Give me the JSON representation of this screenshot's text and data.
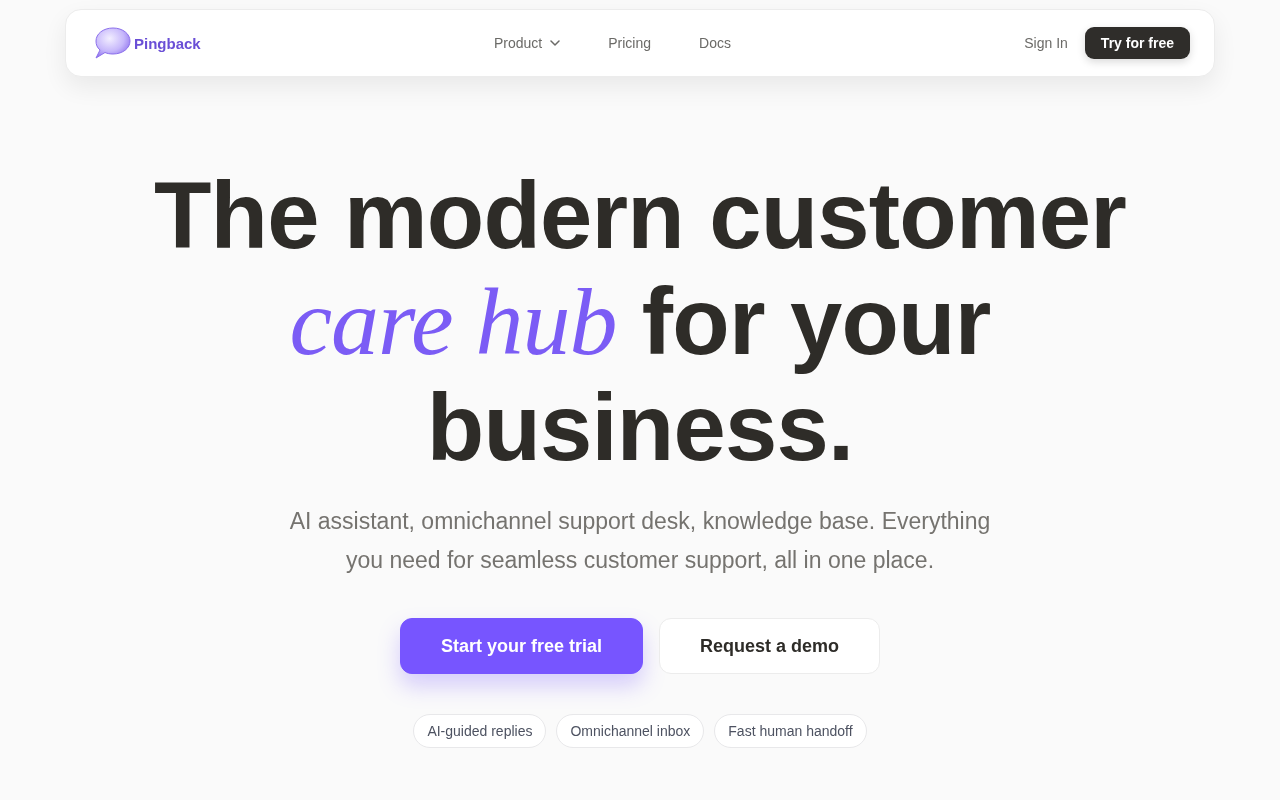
{
  "nav": {
    "brand": "Pingback",
    "links": [
      {
        "label": "Product",
        "kind": "dropdown"
      },
      {
        "label": "Pricing",
        "kind": "link"
      },
      {
        "label": "Docs",
        "kind": "link"
      }
    ],
    "sign_in": "Sign In",
    "cta": "Try for free"
  },
  "hero": {
    "headline": "The modern customer *care hub* for your business.",
    "subtitle": "AI assistant, omnichannel support desk, knowledge base. Everything you need for seamless customer support, all in one place.",
    "buttons": [
      {
        "label": "Start your free trial",
        "kind": "primary"
      },
      {
        "label": "Request a demo",
        "kind": "secondary"
      }
    ],
    "tags": [
      "AI-guided replies",
      "Omnichannel inbox",
      "Fast human handoff"
    ]
  }
}
